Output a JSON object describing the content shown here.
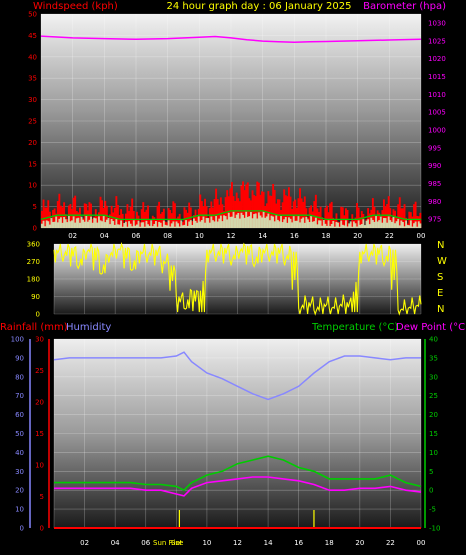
{
  "header": {
    "title": "24 hour graph day : 06 January 2025",
    "left_label": "Windspeed (kph)",
    "right_label": "Barometer (hpa)"
  },
  "panel2": {
    "compass": [
      "N",
      "W",
      "S",
      "E",
      "N"
    ]
  },
  "panel3": {
    "rain_label": "Rainfall (mm)",
    "humidity_label": "Humidity",
    "temp_label": "Temperature (°C)",
    "dew_label": "Dew Point (°C)",
    "sunrise_label": "Sun Rise",
    "sunset_label": "Set"
  },
  "colors": {
    "wind": "#ff0000",
    "gust_fill": "#ff0000",
    "avg_wind": "#00cc00",
    "barometer": "#ff00ff",
    "direction": "#ffff00",
    "humidity": "#8888ff",
    "temperature": "#00cc00",
    "dewpoint": "#ff00ff",
    "rain": "#ff0000",
    "sun_marker": "#ffff00",
    "grid": "#ffffff"
  },
  "chart_data": [
    {
      "type": "area",
      "name": "wind-and-pressure",
      "x_ticks": [
        "02",
        "04",
        "06",
        "08",
        "10",
        "12",
        "14",
        "16",
        "18",
        "20",
        "22",
        "00"
      ],
      "y_left": {
        "label": "Windspeed (kph)",
        "ticks": [
          0,
          5,
          10,
          15,
          20,
          25,
          30,
          35,
          40,
          45,
          50
        ],
        "ylim": [
          0,
          50
        ]
      },
      "y_right": {
        "label": "Barometer (hpa)",
        "ticks": [
          975,
          980,
          985,
          990,
          995,
          1000,
          1005,
          1010,
          1015,
          1020,
          1025,
          1030
        ],
        "ylim": [
          972.5,
          1032.5
        ]
      },
      "xlim": [
        0,
        24
      ],
      "series": [
        {
          "name": "Windspeed (kph)",
          "axis": "left",
          "x": [
            0,
            1,
            2,
            3,
            4,
            5,
            6,
            7,
            8,
            9,
            10,
            11,
            12,
            13,
            14,
            15,
            16,
            17,
            18,
            19,
            20,
            21,
            22,
            23,
            24
          ],
          "values": [
            4,
            5,
            5,
            4,
            5,
            4,
            4,
            3,
            4,
            3,
            5,
            6,
            8,
            9,
            8,
            7,
            7,
            5,
            4,
            3,
            3,
            4,
            5,
            4,
            3
          ]
        },
        {
          "axis": "left",
          "x": [
            0,
            1,
            2,
            3,
            4,
            5,
            6,
            7,
            8,
            9,
            10,
            11,
            12,
            13,
            14,
            15,
            16,
            17,
            18,
            19,
            20,
            21,
            22,
            23,
            24
          ],
          "values": [
            1,
            2,
            2,
            2,
            2,
            1,
            1,
            1,
            1,
            1,
            2,
            2,
            3,
            3,
            3,
            2,
            2,
            2,
            1,
            1,
            1,
            2,
            2,
            1,
            1
          ]
        },
        {
          "name": "Barometer (hpa)",
          "axis": "right",
          "x": [
            0,
            2,
            4,
            6,
            8,
            10,
            11,
            12,
            13,
            14,
            15,
            16,
            17,
            18,
            20,
            22,
            24
          ],
          "values": [
            1026.3,
            1025.8,
            1025.6,
            1025.4,
            1025.6,
            1026.0,
            1026.2,
            1025.8,
            1025.3,
            1024.9,
            1024.7,
            1024.6,
            1024.7,
            1024.8,
            1025.0,
            1025.2,
            1025.4
          ]
        }
      ]
    },
    {
      "type": "line",
      "name": "wind-direction",
      "y": {
        "ticks": [
          0,
          90,
          180,
          270,
          360
        ],
        "ylim": [
          0,
          360
        ]
      },
      "xlim": [
        0,
        24
      ],
      "series": [
        {
          "name": "Direction",
          "x": [
            0,
            0.5,
            1,
            1.5,
            2,
            2.5,
            3,
            3.5,
            4,
            4.5,
            5,
            5.5,
            6,
            6.5,
            7,
            7.5,
            8,
            8.5,
            9,
            9.5,
            10,
            10.5,
            11,
            11.5,
            12,
            12.5,
            13,
            13.5,
            14,
            14.5,
            15,
            15.5,
            16,
            16.5,
            17,
            17.5,
            18,
            18.5,
            19,
            19.5,
            20,
            20.5,
            21,
            21.5,
            22,
            22.5,
            23,
            23.5,
            24
          ],
          "values": [
            330,
            300,
            340,
            250,
            320,
            340,
            210,
            300,
            330,
            340,
            230,
            320,
            300,
            330,
            270,
            250,
            90,
            30,
            120,
            10,
            330,
            300,
            340,
            280,
            320,
            350,
            260,
            330,
            300,
            340,
            280,
            320,
            30,
            60,
            20,
            50,
            30,
            40,
            60,
            10,
            320,
            300,
            340,
            270,
            330,
            20,
            30,
            40,
            50
          ]
        }
      ]
    },
    {
      "type": "line",
      "name": "temp-humidity-rain",
      "y_left_rain": {
        "label": "Rainfall (mm)",
        "ticks": [
          0,
          5,
          10,
          15,
          20,
          25,
          30
        ],
        "ylim": [
          0,
          30
        ]
      },
      "y_left_hum": {
        "label": "Humidity",
        "ticks": [
          0,
          10,
          20,
          30,
          40,
          50,
          60,
          70,
          80,
          90,
          100
        ],
        "ylim": [
          0,
          100
        ]
      },
      "y_right": {
        "label": "Temperature (°C)",
        "ticks": [
          -10,
          -5,
          0,
          5,
          10,
          15,
          20,
          25,
          30,
          35,
          40
        ],
        "ylim": [
          -10,
          40
        ]
      },
      "sun_rise": 8.2,
      "sun_set": 17.0,
      "xlim": [
        0,
        24
      ],
      "series": [
        {
          "name": "Humidity",
          "axis": "humidity",
          "x": [
            0,
            1,
            2,
            3,
            4,
            5,
            6,
            7,
            8,
            8.5,
            9,
            10,
            11,
            12,
            13,
            14,
            15,
            16,
            17,
            18,
            19,
            20,
            21,
            22,
            23,
            24
          ],
          "values": [
            89,
            90,
            90,
            90,
            90,
            90,
            90,
            90,
            91,
            93,
            88,
            82,
            79,
            75,
            71,
            68,
            71,
            75,
            82,
            88,
            91,
            91,
            90,
            89,
            90,
            90
          ]
        },
        {
          "name": "Temperature (°C)",
          "axis": "temp",
          "x": [
            0,
            1,
            2,
            3,
            4,
            5,
            6,
            7,
            8,
            8.5,
            9,
            10,
            11,
            12,
            13,
            14,
            15,
            16,
            17,
            18,
            19,
            20,
            21,
            22,
            23,
            24
          ],
          "values": [
            2,
            2,
            2,
            2,
            2,
            2,
            1.5,
            1.5,
            1,
            0,
            2,
            4,
            5,
            7,
            8,
            9,
            8,
            6,
            5,
            3,
            3,
            3,
            3,
            4,
            2,
            1
          ]
        },
        {
          "name": "Dew Point (°C)",
          "axis": "temp",
          "x": [
            0,
            1,
            2,
            3,
            4,
            5,
            6,
            7,
            8,
            8.5,
            9,
            10,
            11,
            12,
            13,
            14,
            15,
            16,
            17,
            18,
            19,
            20,
            21,
            22,
            23,
            24
          ],
          "values": [
            0.5,
            0.5,
            0.5,
            0.5,
            0.5,
            0.5,
            0,
            0,
            -1,
            -1.5,
            0.5,
            2,
            2.5,
            3,
            3.5,
            3.5,
            3,
            2.5,
            1.5,
            0,
            0,
            0.5,
            0.5,
            1,
            0,
            -0.5
          ]
        },
        {
          "name": "Rainfall (mm)",
          "axis": "rain",
          "x": [
            0,
            24
          ],
          "values": [
            0,
            0
          ]
        }
      ]
    }
  ]
}
